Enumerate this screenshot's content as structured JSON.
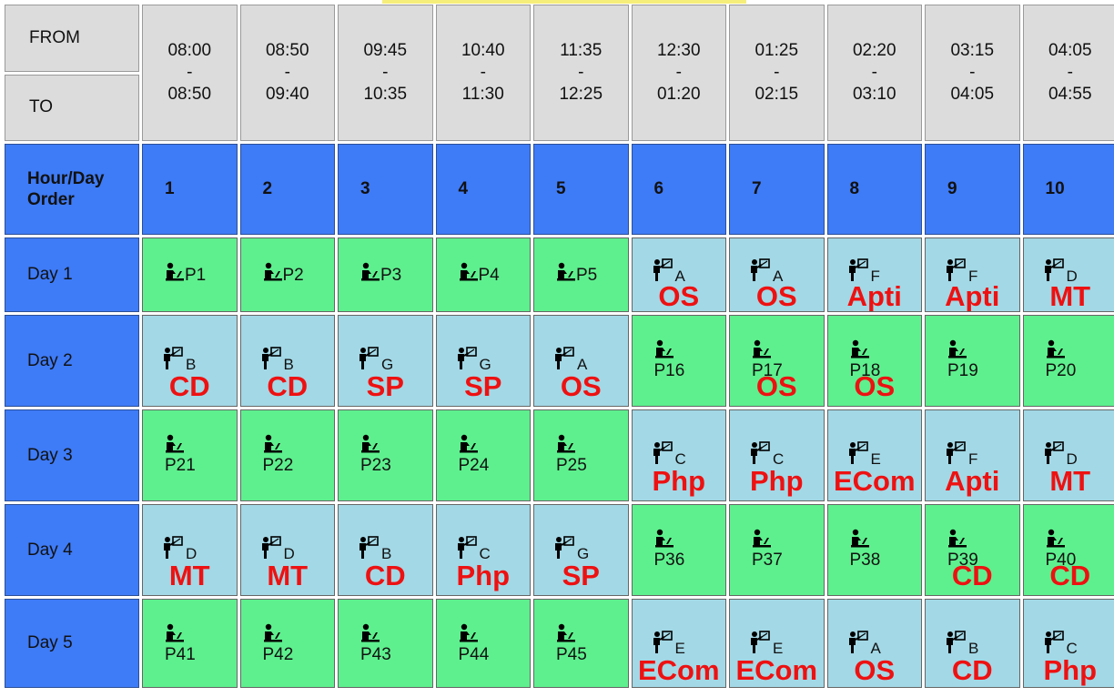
{
  "header": {
    "from_label": "FROM",
    "to_label": "TO",
    "hour_day_label": "Hour/Day Order",
    "times": [
      {
        "from": "08:00",
        "sep": "-",
        "to": "08:50"
      },
      {
        "from": "08:50",
        "sep": "-",
        "to": "09:40"
      },
      {
        "from": "09:45",
        "sep": "-",
        "to": "10:35"
      },
      {
        "from": "10:40",
        "sep": "-",
        "to": "11:30"
      },
      {
        "from": "11:35",
        "sep": "-",
        "to": "12:25"
      },
      {
        "from": "12:30",
        "sep": "-",
        "to": "01:20"
      },
      {
        "from": "01:25",
        "sep": "-",
        "to": "02:15"
      },
      {
        "from": "02:20",
        "sep": "-",
        "to": "03:10"
      },
      {
        "from": "03:15",
        "sep": "-",
        "to": "04:05"
      },
      {
        "from": "04:05",
        "sep": "-",
        "to": "04:55"
      }
    ],
    "hours": [
      "1",
      "2",
      "3",
      "4",
      "5",
      "6",
      "7",
      "8",
      "9",
      "10"
    ]
  },
  "days": [
    {
      "label": "Day 1",
      "cells": [
        {
          "type": "lab",
          "text": "P1"
        },
        {
          "type": "lab",
          "text": "P2"
        },
        {
          "type": "lab",
          "text": "P3"
        },
        {
          "type": "lab",
          "text": "P4"
        },
        {
          "type": "lab",
          "text": "P5"
        },
        {
          "type": "theory",
          "letter": "A",
          "subject": "OS"
        },
        {
          "type": "theory",
          "letter": "A",
          "subject": "OS"
        },
        {
          "type": "theory",
          "letter": "F",
          "subject": "Apti"
        },
        {
          "type": "theory",
          "letter": "F",
          "subject": "Apti"
        },
        {
          "type": "theory",
          "letter": "D",
          "subject": "MT"
        }
      ]
    },
    {
      "label": "Day 2",
      "cells": [
        {
          "type": "theory",
          "letter": "B",
          "subject": "CD"
        },
        {
          "type": "theory",
          "letter": "B",
          "subject": "CD"
        },
        {
          "type": "theory",
          "letter": "G",
          "subject": "SP"
        },
        {
          "type": "theory",
          "letter": "G",
          "subject": "SP"
        },
        {
          "type": "theory",
          "letter": "A",
          "subject": "OS"
        },
        {
          "type": "lab2",
          "text": "P16",
          "subject": ""
        },
        {
          "type": "lab2",
          "text": "P17",
          "subject": "OS"
        },
        {
          "type": "lab2",
          "text": "P18",
          "subject": "OS"
        },
        {
          "type": "lab2",
          "text": "P19",
          "subject": ""
        },
        {
          "type": "lab2",
          "text": "P20",
          "subject": ""
        }
      ]
    },
    {
      "label": "Day 3",
      "cells": [
        {
          "type": "lab2",
          "text": "P21",
          "subject": ""
        },
        {
          "type": "lab2",
          "text": "P22",
          "subject": ""
        },
        {
          "type": "lab2",
          "text": "P23",
          "subject": ""
        },
        {
          "type": "lab2",
          "text": "P24",
          "subject": ""
        },
        {
          "type": "lab2",
          "text": "P25",
          "subject": ""
        },
        {
          "type": "theory",
          "letter": "C",
          "subject": "Php"
        },
        {
          "type": "theory",
          "letter": "C",
          "subject": "Php"
        },
        {
          "type": "theory",
          "letter": "E",
          "subject": "ECom"
        },
        {
          "type": "theory",
          "letter": "F",
          "subject": "Apti"
        },
        {
          "type": "theory",
          "letter": "D",
          "subject": "MT"
        }
      ]
    },
    {
      "label": "Day 4",
      "cells": [
        {
          "type": "theory",
          "letter": "D",
          "subject": "MT"
        },
        {
          "type": "theory",
          "letter": "D",
          "subject": "MT"
        },
        {
          "type": "theory",
          "letter": "B",
          "subject": "CD"
        },
        {
          "type": "theory",
          "letter": "C",
          "subject": "Php"
        },
        {
          "type": "theory",
          "letter": "G",
          "subject": "SP"
        },
        {
          "type": "lab2",
          "text": "P36",
          "subject": ""
        },
        {
          "type": "lab2",
          "text": "P37",
          "subject": ""
        },
        {
          "type": "lab2",
          "text": "P38",
          "subject": ""
        },
        {
          "type": "lab2",
          "text": "P39",
          "subject": "CD"
        },
        {
          "type": "lab2",
          "text": "P40",
          "subject": "CD"
        }
      ]
    },
    {
      "label": "Day 5",
      "cells": [
        {
          "type": "lab2",
          "text": "P41",
          "subject": ""
        },
        {
          "type": "lab2",
          "text": "P42",
          "subject": ""
        },
        {
          "type": "lab2",
          "text": "P43",
          "subject": ""
        },
        {
          "type": "lab2",
          "text": "P44",
          "subject": ""
        },
        {
          "type": "lab2",
          "text": "P45",
          "subject": ""
        },
        {
          "type": "theory",
          "letter": "E",
          "subject": "ECom"
        },
        {
          "type": "theory",
          "letter": "E",
          "subject": "ECom"
        },
        {
          "type": "theory",
          "letter": "A",
          "subject": "OS"
        },
        {
          "type": "theory",
          "letter": "B",
          "subject": "CD"
        },
        {
          "type": "theory",
          "letter": "C",
          "subject": "Php"
        }
      ]
    }
  ],
  "colors": {
    "header_gray": "#dcdcdc",
    "hour_blue": "#3e7bf7",
    "lab_green": "#5ef08e",
    "theory_light_blue": "#a3d8e6",
    "subject_red": "#ee1111"
  },
  "icons": {
    "lab": "student-at-computer-icon",
    "theory": "teacher-at-board-icon"
  }
}
